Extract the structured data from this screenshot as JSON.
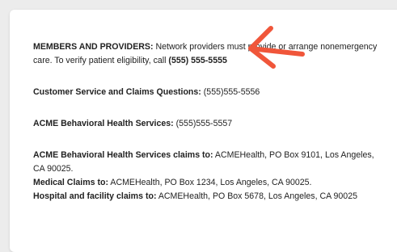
{
  "notice": {
    "members_label": "MEMBERS AND PROVIDERS:",
    "members_text_1": " Network providers must provide or arrange nonemergency",
    "members_text_2": "care. To verify patient eligibility, call ",
    "members_phone": "(555) 555-5555",
    "customer_service_label": "Customer Service and Claims Questions:",
    "customer_service_phone": " (555)555-5556",
    "behavioral_label": "ACME Behavioral Health Services:",
    "behavioral_phone": " (555)555-5557",
    "behavioral_claims_label": "ACME Behavioral Health Services claims to:",
    "behavioral_claims_address_1": " ACMEHealth, PO Box 9101, Los Angeles,",
    "behavioral_claims_address_2": "CA 90025.",
    "medical_claims_label": "Medical Claims to:",
    "medical_claims_address": " ACMEHealth, PO Box 1234, Los Angeles, CA 90025.",
    "hospital_claims_label": "Hospital and facility claims to:",
    "hospital_claims_address": " ACMEHealth, PO Box 5678, Los Angeles, CA 90025"
  },
  "annotation": {
    "arrow_color": "#f0563a",
    "icon": "arrow-annotation-icon"
  }
}
